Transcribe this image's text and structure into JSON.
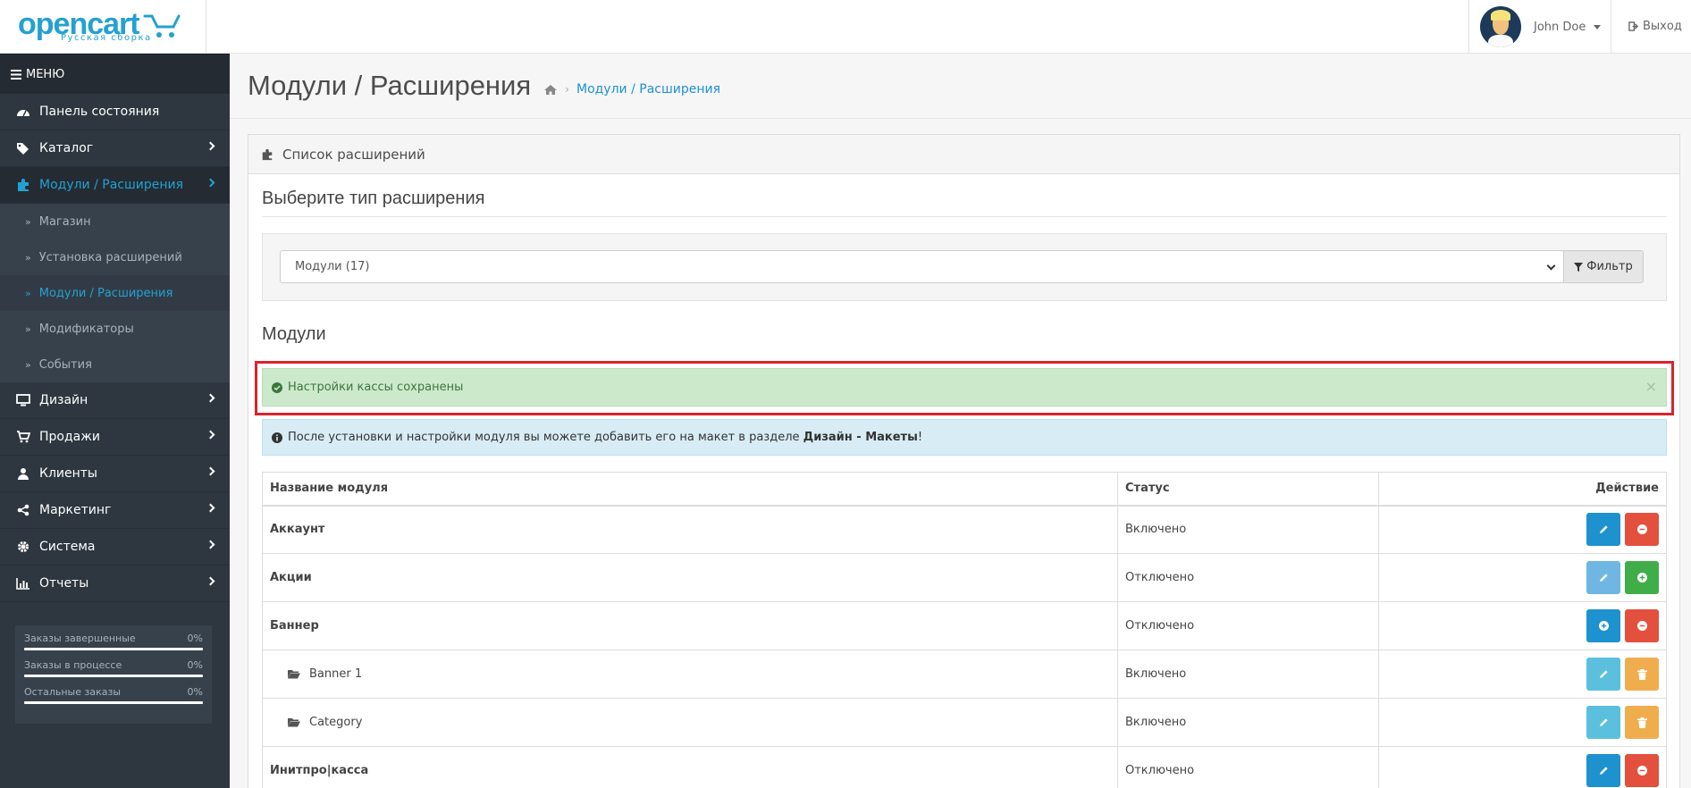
{
  "header": {
    "logo_text": "opencart",
    "logo_sub": "Русская сборка",
    "user_name": "John Doe",
    "logout_label": "Выход"
  },
  "sidebar": {
    "menu_label": "МЕНЮ",
    "items": [
      {
        "label": "Панель состояния",
        "icon": "dashboard-icon"
      },
      {
        "label": "Каталог",
        "icon": "tags-icon"
      },
      {
        "label": "Модули / Расширения",
        "icon": "puzzle-icon",
        "active": true
      },
      {
        "label": "Дизайн",
        "icon": "desktop-icon"
      },
      {
        "label": "Продажи",
        "icon": "cart-icon"
      },
      {
        "label": "Клиенты",
        "icon": "user-icon"
      },
      {
        "label": "Маркетинг",
        "icon": "share-icon"
      },
      {
        "label": "Система",
        "icon": "gear-icon"
      },
      {
        "label": "Отчеты",
        "icon": "bar-chart-icon"
      }
    ],
    "subitems": [
      {
        "label": "Магазин"
      },
      {
        "label": "Установка расширений"
      },
      {
        "label": "Модули / Расширения",
        "active": true
      },
      {
        "label": "Модификаторы"
      },
      {
        "label": "События"
      }
    ],
    "stats": [
      {
        "label": "Заказы завершенные",
        "value": "0%"
      },
      {
        "label": "Заказы в процессе",
        "value": "0%"
      },
      {
        "label": "Остальные заказы",
        "value": "0%"
      }
    ]
  },
  "page": {
    "title": "Модули / Расширения",
    "breadcrumb": "Модули / Расширения"
  },
  "panel": {
    "heading": "Список расширений",
    "choose_type": "Выберите тип расширения",
    "select_value": "Модули (17)",
    "filter_label": "Фильтр",
    "modules_title": "Модули",
    "success_text": "Настройки кассы сохранены",
    "close_glyph": "×",
    "info_text_prefix": "После установки и настройки модуля вы можете добавить его на макет в разделе ",
    "info_text_bold": "Дизайн - Макеты",
    "info_text_suffix": "!"
  },
  "table": {
    "headers": [
      "Название модуля",
      "Статус",
      "Действие"
    ],
    "rows": [
      {
        "name": "Аккаунт",
        "status": "Включено"
      },
      {
        "name": "Акции",
        "status": "Отключено"
      },
      {
        "name": "Баннер",
        "status": "Отключено"
      },
      {
        "name": "Banner 1",
        "status": "Включено"
      },
      {
        "name": "Category",
        "status": "Включено"
      },
      {
        "name": "Инитпро|касса",
        "status": "Отключено"
      }
    ]
  },
  "colors": {
    "accent": "#1e91cf",
    "sidebar_bg": "#2e3740",
    "success_bg": "#cde9cc",
    "info_bg": "#d8ecf5",
    "danger": "#e3503e",
    "highlight_border": "#d9232d"
  }
}
